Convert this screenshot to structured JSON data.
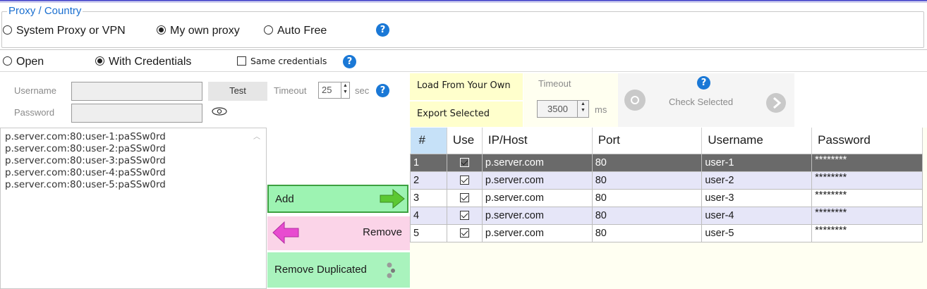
{
  "proxy_country": {
    "title": "Proxy / Country",
    "options": [
      {
        "label": "System Proxy or VPN",
        "checked": false
      },
      {
        "label": "My own proxy",
        "checked": true
      },
      {
        "label": "Auto Free",
        "checked": false
      }
    ]
  },
  "auth": {
    "open_label": "Open",
    "with_credentials_label": "With Credentials",
    "same_credentials_label": "Same credentials",
    "username_label": "Username",
    "password_label": "Password",
    "test_label": "Test",
    "timeout_label": "Timeout",
    "timeout_value": "25",
    "timeout_unit": "sec"
  },
  "load": {
    "load_label": "Load From Your Own",
    "export_label": "Export Selected",
    "timeout_label": "Timeout",
    "timeout_value": "3500",
    "timeout_unit": "ms",
    "check_selected_label": "Check Selected"
  },
  "proxy_list": [
    "p.server.com:80:user-1:paSSw0rd",
    "p.server.com:80:user-2:paSSw0rd",
    "p.server.com:80:user-3:paSSw0rd",
    "p.server.com:80:user-4:paSSw0rd",
    "p.server.com:80:user-5:paSSw0rd"
  ],
  "actions": {
    "add_label": "Add",
    "remove_label": "Remove",
    "remove_duplicated_label": "Remove Duplicated"
  },
  "table": {
    "columns": [
      "#",
      "Use",
      "IP/Host",
      "Port",
      "Username",
      "Password"
    ],
    "rows": [
      {
        "num": "1",
        "use": true,
        "host": "p.server.com",
        "port": "80",
        "user": "user-1",
        "pass": "********"
      },
      {
        "num": "2",
        "use": true,
        "host": "p.server.com",
        "port": "80",
        "user": "user-2",
        "pass": "********"
      },
      {
        "num": "3",
        "use": true,
        "host": "p.server.com",
        "port": "80",
        "user": "user-3",
        "pass": "********"
      },
      {
        "num": "4",
        "use": true,
        "host": "p.server.com",
        "port": "80",
        "user": "user-4",
        "pass": "********"
      },
      {
        "num": "5",
        "use": true,
        "host": "p.server.com",
        "port": "80",
        "user": "user-5",
        "pass": "********"
      }
    ]
  },
  "colors": {
    "accent_blue": "#1a78d6",
    "title_blue": "#1a6fd0",
    "selected_row": "#6a6a6a",
    "alt_row": "#e6e6f8",
    "add_green": "#9df3b2",
    "remove_pink": "#fbd4e8"
  }
}
